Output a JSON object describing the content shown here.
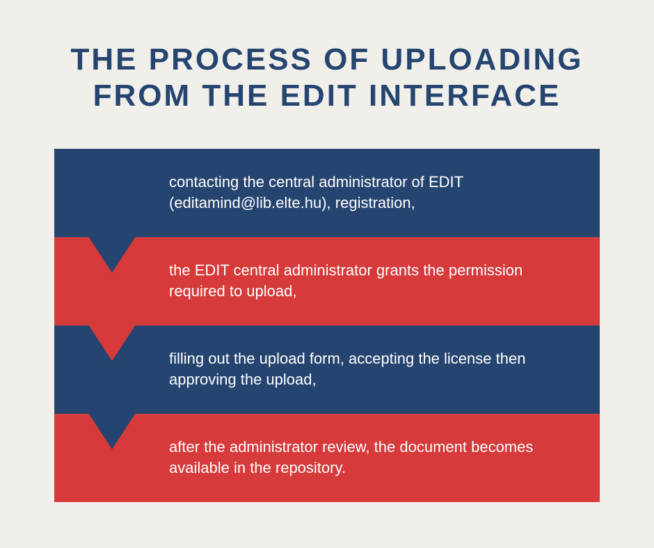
{
  "title": "THE PROCESS OF UPLOADING FROM THE EDIT INTERFACE",
  "colors": {
    "blue": "#254470",
    "red": "#d63a3a",
    "background": "#f0efea"
  },
  "steps": [
    {
      "text": "contacting the central administrator of EDIT (editamind@lib.elte.hu), registration,"
    },
    {
      "text": "the EDIT central administrator grants the permission required to upload,"
    },
    {
      "text": "filling out the upload form, accepting the license then approving the upload,"
    },
    {
      "text": "after the administrator review, the document becomes available in the repository."
    }
  ]
}
